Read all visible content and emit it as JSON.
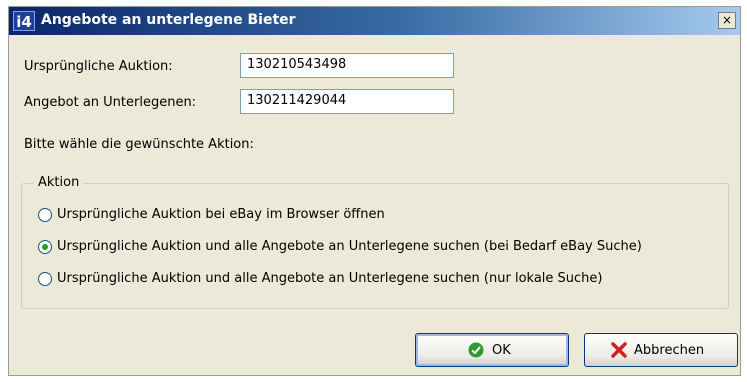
{
  "window": {
    "title": "Angebote an unterlegene Bieter",
    "app_icon_text": "i4",
    "close_glyph": "×"
  },
  "form": {
    "orig_auction_label": "Ursprüngliche Auktion:",
    "orig_auction_value": "130210543498",
    "offer_label": "Angebot an Unterlegenen:",
    "offer_value": "130211429044",
    "instruction": "Bitte wähle die gewünschte Aktion:"
  },
  "group": {
    "legend": "Aktion",
    "options": [
      {
        "label": "Ursprüngliche Auktion bei eBay im Browser öffnen",
        "selected": false
      },
      {
        "label": "Ursprüngliche Auktion und alle Angebote an Unterlegene suchen (bei Bedarf eBay Suche)",
        "selected": true
      },
      {
        "label": "Ursprüngliche Auktion und alle Angebote an Unterlegene suchen (nur lokale Suche)",
        "selected": false
      }
    ]
  },
  "buttons": {
    "ok_label": "OK",
    "cancel_label": "Abbrechen",
    "ok_icon": "check-icon",
    "cancel_icon": "cross-icon"
  },
  "colors": {
    "titlebar_start": "#0a246a",
    "titlebar_end": "#a6caf0",
    "dialog_bg": "#ece9d8",
    "ok_green": "#2f9a2f",
    "cancel_red": "#d02020"
  }
}
